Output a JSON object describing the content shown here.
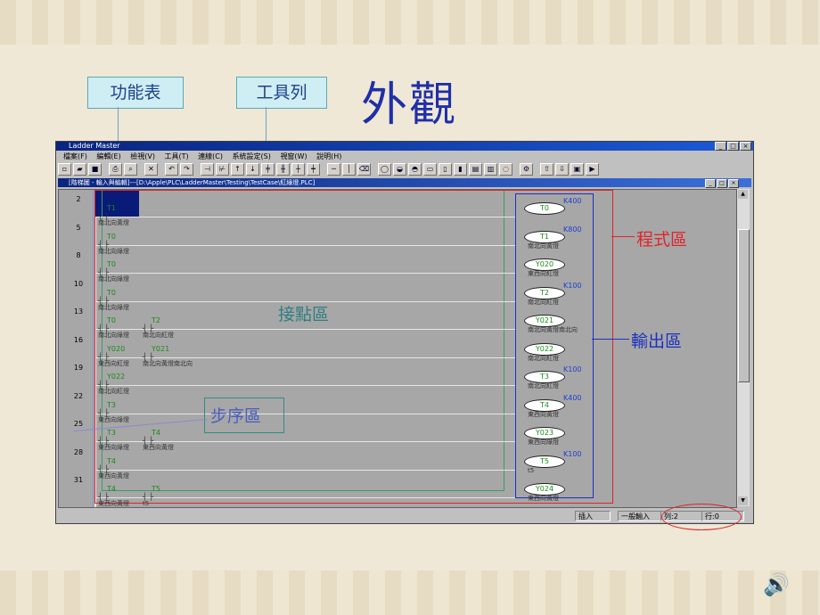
{
  "slide": {
    "title": "外觀"
  },
  "callouts": {
    "menu": "功能表",
    "toolbar": "工具列"
  },
  "annotations": {
    "program_area": "程式區",
    "output_area": "輸出區",
    "contact_area": "接點區",
    "step_area": "步序區"
  },
  "window": {
    "title": "Ladder Master",
    "menus": [
      "檔案(F)",
      "編輯(E)",
      "檢視(V)",
      "工具(T)",
      "連線(C)",
      "系統設定(S)",
      "視窗(W)",
      "說明(H)"
    ],
    "doc_title": "[階梯圖 - 輸入與編輯]---[D:\\Apple\\PLC\\LadderMaster\\Testing\\TestCase\\紅綠燈.PLC]",
    "status": {
      "mode": "插入",
      "input": "一般輸入",
      "col": "列:2",
      "row": "行:0"
    }
  },
  "ladder": {
    "steps": [
      "2",
      "5",
      "8",
      "10",
      "13",
      "16",
      "19",
      "22",
      "25",
      "28",
      "31"
    ],
    "rungs": [
      {
        "contacts": [
          {
            "dev": "T1",
            "lbl": "南北向黃燈"
          }
        ],
        "coil": "T0",
        "coil_lbl": "",
        "k": "K400"
      },
      {
        "contacts": [
          {
            "dev": "T0",
            "lbl": "南北向綠燈"
          }
        ],
        "coil": "T1",
        "coil_lbl": "南北向黃燈",
        "k": "K800"
      },
      {
        "contacts": [
          {
            "dev": "T0",
            "lbl": "南北向綠燈"
          }
        ],
        "coil": "Y020",
        "coil_lbl": "東西向紅燈",
        "k": ""
      },
      {
        "contacts": [
          {
            "dev": "T0",
            "lbl": "南北向綠燈"
          }
        ],
        "coil": "T2",
        "coil_lbl": "南北向紅燈",
        "k": "K100"
      },
      {
        "contacts": [
          {
            "dev": "T0",
            "lbl": "南北向綠燈"
          },
          {
            "dev": "T2",
            "lbl": "南北向紅燈"
          }
        ],
        "coil": "Y021",
        "coil_lbl": "南北向黃燈南北向",
        "k": ""
      },
      {
        "contacts": [
          {
            "dev": "Y020",
            "lbl": "東西向紅燈"
          },
          {
            "dev": "Y021",
            "lbl": "南北向黃燈南北向"
          }
        ],
        "coil": "Y022",
        "coil_lbl": "南北向紅燈",
        "k": ""
      },
      {
        "contacts": [
          {
            "dev": "Y022",
            "lbl": "南北向紅燈"
          }
        ],
        "coil": "T3",
        "coil_lbl": "南北向紅燈",
        "k": "K100"
      },
      {
        "contacts": [
          {
            "dev": "T3",
            "lbl": "東西向綠燈"
          }
        ],
        "coil": "T4",
        "coil_lbl": "東西向黃燈",
        "k": "K400"
      },
      {
        "contacts": [
          {
            "dev": "T3",
            "lbl": "東西向綠燈"
          },
          {
            "dev": "T4",
            "lbl": "東西向黃燈"
          }
        ],
        "coil": "Y023",
        "coil_lbl": "東西向綠燈",
        "k": ""
      },
      {
        "contacts": [
          {
            "dev": "T4",
            "lbl": "東西向黃燈"
          }
        ],
        "coil": "T5",
        "coil_lbl": "t5",
        "k": "K100"
      },
      {
        "contacts": [
          {
            "dev": "T4",
            "lbl": "東西向黃燈"
          },
          {
            "dev": "T5",
            "lbl": "t5"
          }
        ],
        "coil": "Y024",
        "coil_lbl": "東西向黃燈",
        "k": ""
      }
    ]
  },
  "colors": {
    "title_blue": "#1f2fa8",
    "program_red": "#e0242a",
    "output_blue": "#1c2fc2",
    "contact_green": "#3b9a6a",
    "step_teal": "#2f8c86"
  }
}
